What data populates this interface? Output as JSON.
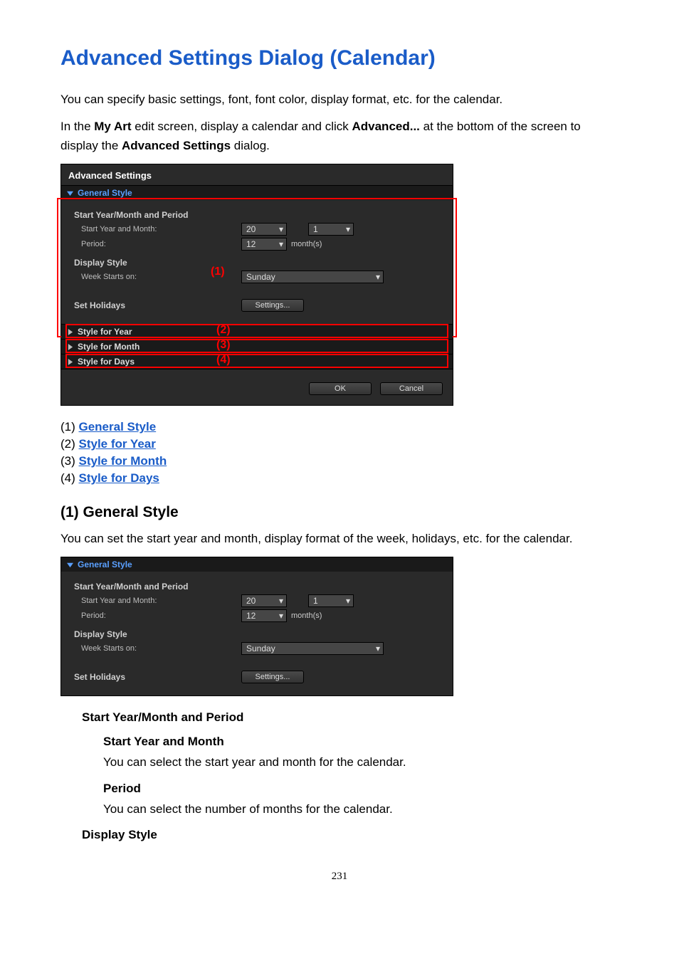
{
  "title": "Advanced Settings Dialog (Calendar)",
  "intro1": "You can specify basic settings, font, font color, display format, etc. for the calendar.",
  "intro2_a": "In the ",
  "intro2_b": "My Art",
  "intro2_c": " edit screen, display a calendar and click ",
  "intro2_d": "Advanced...",
  "intro2_e": " at the bottom of the screen to display the ",
  "intro2_f": "Advanced Settings",
  "intro2_g": " dialog.",
  "dialog": {
    "title": "Advanced Settings",
    "general": {
      "header": "General Style",
      "group_period": "Start Year/Month and Period",
      "label_start": "Start Year and Month:",
      "label_period": "Period:",
      "val_year": "20",
      "val_month": "1",
      "val_period": "12",
      "unit_months": "month(s)",
      "group_display": "Display Style",
      "label_week": "Week Starts on:",
      "val_week": "Sunday",
      "group_holidays": "Set Holidays",
      "btn_settings": "Settings..."
    },
    "rows": {
      "year": "Style for Year",
      "month": "Style for Month",
      "days": "Style for Days"
    },
    "ok": "OK",
    "cancel": "Cancel"
  },
  "callouts": {
    "c1": "(1)",
    "c2": "(2)",
    "c3": "(3)",
    "c4": "(4)"
  },
  "links": {
    "l1n": "(1) ",
    "l1": "General Style",
    "l2n": "(2) ",
    "l2": "Style for Year",
    "l3n": "(3) ",
    "l3": "Style for Month",
    "l4n": "(4) ",
    "l4": "Style for Days"
  },
  "section1": {
    "heading": "(1) General Style",
    "body": "You can set the start year and month, display format of the week, holidays, etc. for the calendar."
  },
  "defs": {
    "h1": "Start Year/Month and Period",
    "h2": "Start Year and Month",
    "b2": "You can select the start year and month for the calendar.",
    "h3": "Period",
    "b3": "You can select the number of months for the calendar.",
    "h4": "Display Style"
  },
  "pagenum": "231"
}
